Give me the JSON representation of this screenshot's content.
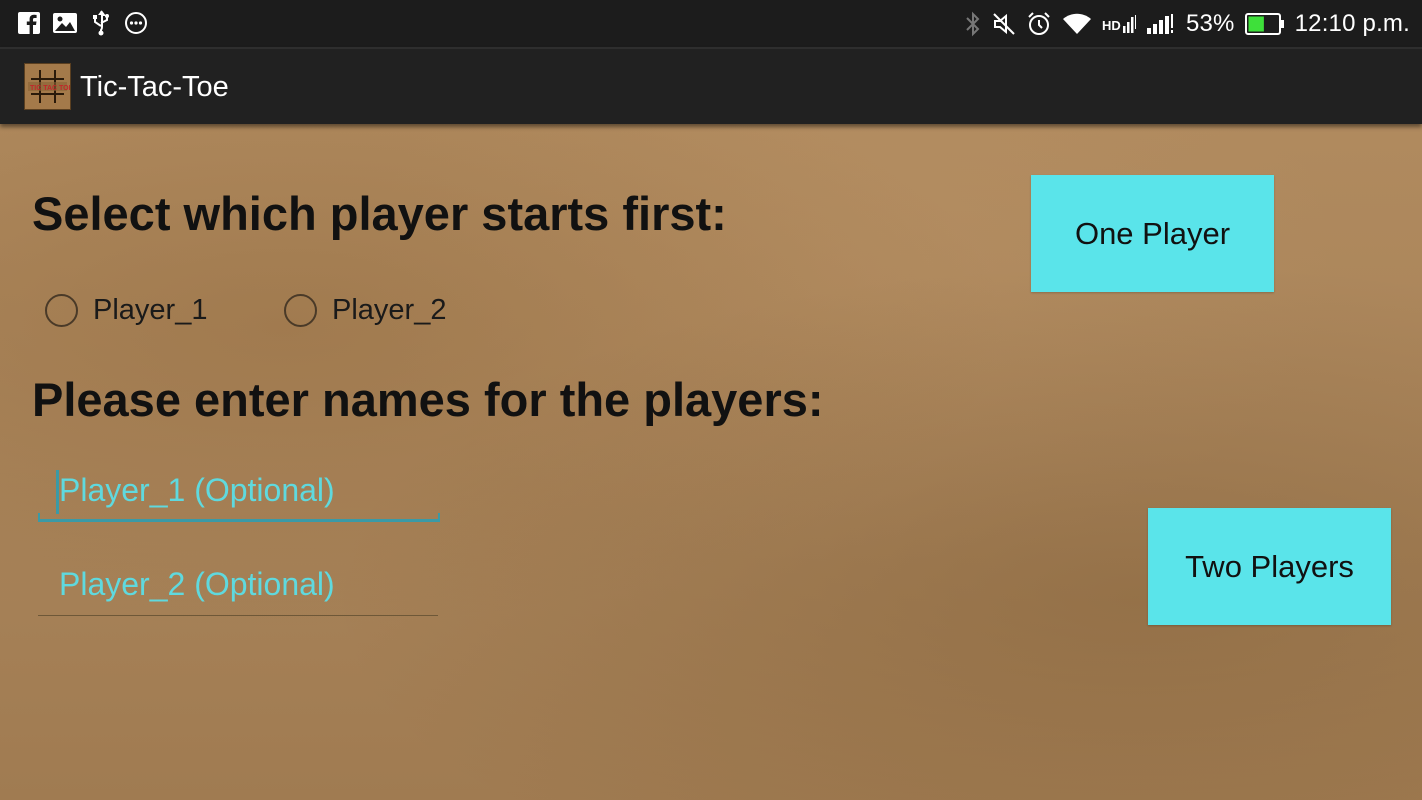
{
  "status_bar": {
    "notification_icons": [
      "facebook-icon",
      "image-icon",
      "usb-icon",
      "more-icon"
    ],
    "system_icons": [
      "bluetooth-icon",
      "mute-icon",
      "alarm-icon",
      "wifi-icon",
      "hd-signal-icon",
      "signal-icon"
    ],
    "battery_percent": "53%",
    "battery_level": 0.53,
    "time": "12:10 p.m."
  },
  "app_bar": {
    "title": "Tic-Tac-Toe",
    "icon": "tic-tac-toe-app-icon"
  },
  "main": {
    "start_heading": "Select which player starts first:",
    "radio_options": [
      {
        "label": "Player_1",
        "checked": false
      },
      {
        "label": "Player_2",
        "checked": false
      }
    ],
    "names_heading": "Please enter names for the players:",
    "player1_placeholder": "Player_1 (Optional)",
    "player2_placeholder": "Player_2 (Optional)",
    "one_player_button": "One Player",
    "two_players_button": "Two Players"
  },
  "colors": {
    "accent": "#5ae4ea",
    "input_text": "#5fd9de",
    "focus_underline": "#3a9aa6",
    "app_bar": "#212121",
    "status_bar": "#1c1c1c",
    "background": "#a9845a"
  }
}
